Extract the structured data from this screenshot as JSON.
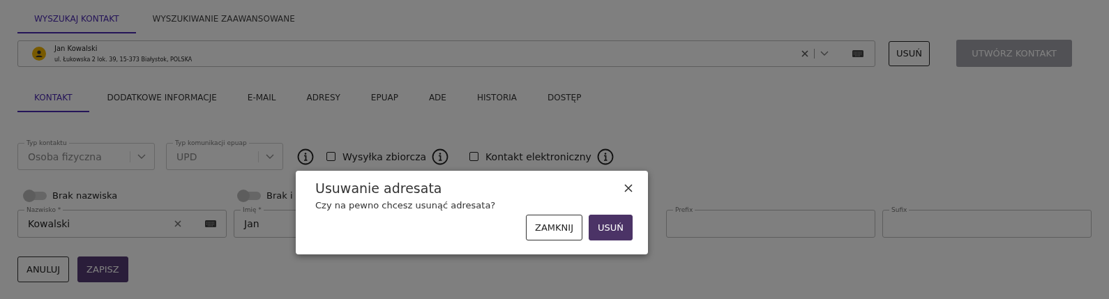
{
  "search_tabs": [
    {
      "label": "WYSZUKAJ KONTAKT",
      "selected": true
    },
    {
      "label": "WYSZUKIWANIE ZAAWANSOWANE",
      "selected": false
    }
  ],
  "contact_search": {
    "name": "Jan Kowalski",
    "address": "ul. Łukowska 2 lok. 39, 15-373 Białystok, POLSKA"
  },
  "search_buttons": [
    {
      "label": "USUŃ",
      "disabled": false
    },
    {
      "label": "UTWÓRZ KONTAKT",
      "disabled": true
    }
  ],
  "contact_tabs": [
    {
      "label": "KONTAKT",
      "selected": true
    },
    {
      "label": "DODATKOWE INFORMACJE",
      "selected": false
    },
    {
      "label": "E-MAIL",
      "selected": false
    },
    {
      "label": "ADRESY",
      "selected": false
    },
    {
      "label": "EPUAP",
      "selected": false
    },
    {
      "label": "ADE",
      "selected": false
    },
    {
      "label": "HISTORIA",
      "selected": false
    },
    {
      "label": "DOSTĘP",
      "selected": false
    }
  ],
  "selects": [
    {
      "label": "Typ kontaktu",
      "value": "Osoba fizyczna",
      "disabled": true
    },
    {
      "label": "Typ komunikacji epuap",
      "value": "UPD",
      "disabled": true
    }
  ],
  "checkboxes": [
    {
      "label": "Wysyłka zbiorcza",
      "checked": false
    },
    {
      "label": "Kontakt elektroniczny",
      "checked": false
    }
  ],
  "toggles": [
    {
      "label": "Brak nazwiska",
      "on": false
    },
    {
      "label": "Brak i",
      "on": false
    }
  ],
  "fields": [
    {
      "label": "Nazwisko *",
      "value": "Kowalski"
    },
    {
      "label": "Imię *",
      "value": "Jan"
    },
    {
      "label": "Prefix"
    },
    {
      "label": "Sufix"
    }
  ],
  "form_buttons": [
    {
      "label": "ANULUJ",
      "kind": "outline"
    },
    {
      "label": "ZAPISZ",
      "kind": "primary"
    }
  ],
  "dialog": {
    "title": "Usuwanie adresata",
    "message": "Czy na pewno chcesz usunąć adresata?",
    "buttons": [
      {
        "label": "ZAMKNIJ",
        "kind": "outline"
      },
      {
        "label": "USUŃ",
        "kind": "primary"
      }
    ]
  }
}
